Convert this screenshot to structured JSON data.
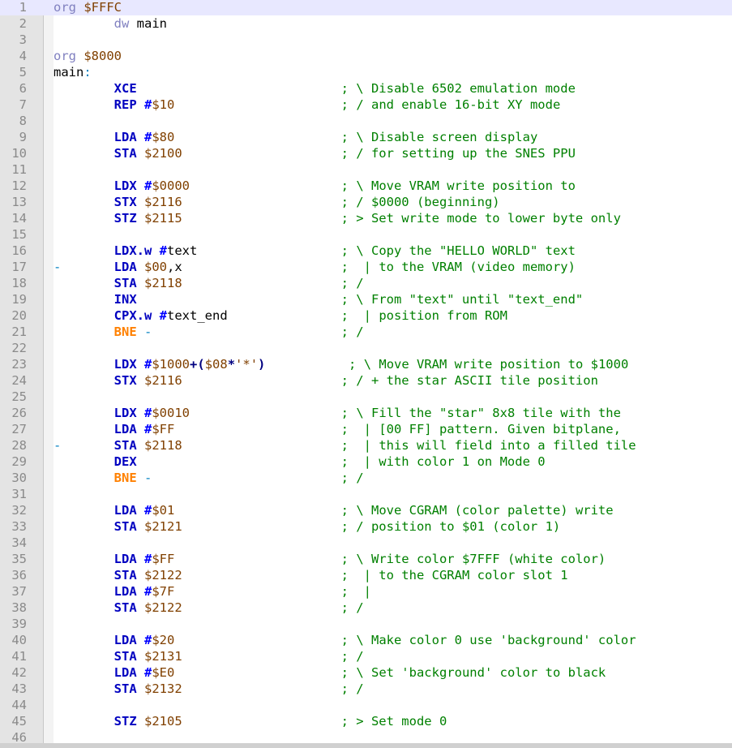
{
  "window": {
    "title": ""
  },
  "editor": {
    "current_line": 1,
    "lines": [
      {
        "n": "1",
        "tokens": [
          {
            "t": "org ",
            "c": "kw"
          },
          {
            "t": "$FFFC",
            "c": "hx"
          }
        ]
      },
      {
        "n": "2",
        "tokens": [
          {
            "t": "        "
          },
          {
            "t": "dw",
            "c": "kw"
          },
          {
            "t": " main"
          }
        ]
      },
      {
        "n": "3",
        "tokens": []
      },
      {
        "n": "4",
        "tokens": [
          {
            "t": "org ",
            "c": "kw"
          },
          {
            "t": "$8000",
            "c": "hx"
          }
        ]
      },
      {
        "n": "5",
        "tokens": [
          {
            "t": "main",
            "c": "lbl"
          },
          {
            "t": ":",
            "c": "sym"
          }
        ]
      },
      {
        "n": "6",
        "tokens": [
          {
            "t": "        "
          },
          {
            "t": "XCE",
            "c": "op"
          },
          {
            "t": "                           "
          },
          {
            "t": "; \\ Disable 6502 emulation mode",
            "c": "cm"
          }
        ]
      },
      {
        "n": "7",
        "tokens": [
          {
            "t": "        "
          },
          {
            "t": "REP",
            "c": "op"
          },
          {
            "t": " "
          },
          {
            "t": "#",
            "c": "im"
          },
          {
            "t": "$10",
            "c": "hx"
          },
          {
            "t": "                      "
          },
          {
            "t": "; / and enable 16-bit XY mode",
            "c": "cm"
          }
        ]
      },
      {
        "n": "8",
        "tokens": []
      },
      {
        "n": "9",
        "tokens": [
          {
            "t": "        "
          },
          {
            "t": "LDA",
            "c": "op"
          },
          {
            "t": " "
          },
          {
            "t": "#",
            "c": "im"
          },
          {
            "t": "$80",
            "c": "hx"
          },
          {
            "t": "                      "
          },
          {
            "t": "; \\ Disable screen display",
            "c": "cm"
          }
        ]
      },
      {
        "n": "10",
        "tokens": [
          {
            "t": "        "
          },
          {
            "t": "STA",
            "c": "op"
          },
          {
            "t": " "
          },
          {
            "t": "$2100",
            "c": "hx"
          },
          {
            "t": "                     "
          },
          {
            "t": "; / for setting up the SNES PPU",
            "c": "cm"
          }
        ]
      },
      {
        "n": "11",
        "tokens": []
      },
      {
        "n": "12",
        "tokens": [
          {
            "t": "        "
          },
          {
            "t": "LDX",
            "c": "op"
          },
          {
            "t": " "
          },
          {
            "t": "#",
            "c": "im"
          },
          {
            "t": "$0000",
            "c": "hx"
          },
          {
            "t": "                    "
          },
          {
            "t": "; \\ Move VRAM write position to",
            "c": "cm"
          }
        ]
      },
      {
        "n": "13",
        "tokens": [
          {
            "t": "        "
          },
          {
            "t": "STX",
            "c": "op"
          },
          {
            "t": " "
          },
          {
            "t": "$2116",
            "c": "hx"
          },
          {
            "t": "                     "
          },
          {
            "t": "; / $0000 (beginning)",
            "c": "cm"
          }
        ]
      },
      {
        "n": "14",
        "tokens": [
          {
            "t": "        "
          },
          {
            "t": "STZ",
            "c": "op"
          },
          {
            "t": " "
          },
          {
            "t": "$2115",
            "c": "hx"
          },
          {
            "t": "                     "
          },
          {
            "t": "; > Set write mode to lower byte only",
            "c": "cm"
          }
        ]
      },
      {
        "n": "15",
        "tokens": []
      },
      {
        "n": "16",
        "tokens": [
          {
            "t": "        "
          },
          {
            "t": "LDX.w",
            "c": "op"
          },
          {
            "t": " "
          },
          {
            "t": "#",
            "c": "im"
          },
          {
            "t": "text"
          },
          {
            "t": "                   "
          },
          {
            "t": "; \\ Copy the \"HELLO WORLD\" text",
            "c": "cm"
          }
        ]
      },
      {
        "n": "17",
        "tokens": [
          {
            "t": "-",
            "c": "sym"
          },
          {
            "t": "       "
          },
          {
            "t": "LDA",
            "c": "op"
          },
          {
            "t": " "
          },
          {
            "t": "$00",
            "c": "hx"
          },
          {
            "t": ",x"
          },
          {
            "t": "                     "
          },
          {
            "t": ";  | to the VRAM (video memory)",
            "c": "cm"
          }
        ]
      },
      {
        "n": "18",
        "tokens": [
          {
            "t": "        "
          },
          {
            "t": "STA",
            "c": "op"
          },
          {
            "t": " "
          },
          {
            "t": "$2118",
            "c": "hx"
          },
          {
            "t": "                     "
          },
          {
            "t": "; /",
            "c": "cm"
          }
        ]
      },
      {
        "n": "19",
        "tokens": [
          {
            "t": "        "
          },
          {
            "t": "INX",
            "c": "op"
          },
          {
            "t": "                           "
          },
          {
            "t": "; \\ From \"text\" until \"text_end\"",
            "c": "cm"
          }
        ]
      },
      {
        "n": "20",
        "tokens": [
          {
            "t": "        "
          },
          {
            "t": "CPX.w",
            "c": "op"
          },
          {
            "t": " "
          },
          {
            "t": "#",
            "c": "im"
          },
          {
            "t": "text_end"
          },
          {
            "t": "               "
          },
          {
            "t": ";  | position from ROM",
            "c": "cm"
          }
        ]
      },
      {
        "n": "21",
        "tokens": [
          {
            "t": "        "
          },
          {
            "t": "BNE",
            "c": "br"
          },
          {
            "t": " "
          },
          {
            "t": "-",
            "c": "sym"
          },
          {
            "t": "                         "
          },
          {
            "t": "; /",
            "c": "cm"
          }
        ]
      },
      {
        "n": "22",
        "tokens": []
      },
      {
        "n": "23",
        "tokens": [
          {
            "t": "        "
          },
          {
            "t": "LDX",
            "c": "op"
          },
          {
            "t": " "
          },
          {
            "t": "#",
            "c": "im"
          },
          {
            "t": "$1000",
            "c": "hx"
          },
          {
            "t": "+(",
            "c": "pr"
          },
          {
            "t": "$08",
            "c": "hx"
          },
          {
            "t": "*",
            "c": "pr"
          },
          {
            "t": "'*'",
            "c": "ch"
          },
          {
            "t": ")",
            "c": "pr"
          },
          {
            "t": "           "
          },
          {
            "t": "; \\ Move VRAM write position to $1000",
            "c": "cm"
          }
        ]
      },
      {
        "n": "24",
        "tokens": [
          {
            "t": "        "
          },
          {
            "t": "STX",
            "c": "op"
          },
          {
            "t": " "
          },
          {
            "t": "$2116",
            "c": "hx"
          },
          {
            "t": "                     "
          },
          {
            "t": "; / + the star ASCII tile position",
            "c": "cm"
          }
        ]
      },
      {
        "n": "25",
        "tokens": []
      },
      {
        "n": "26",
        "tokens": [
          {
            "t": "        "
          },
          {
            "t": "LDX",
            "c": "op"
          },
          {
            "t": " "
          },
          {
            "t": "#",
            "c": "im"
          },
          {
            "t": "$0010",
            "c": "hx"
          },
          {
            "t": "                    "
          },
          {
            "t": "; \\ Fill the \"star\" 8x8 tile with the",
            "c": "cm"
          }
        ]
      },
      {
        "n": "27",
        "tokens": [
          {
            "t": "        "
          },
          {
            "t": "LDA",
            "c": "op"
          },
          {
            "t": " "
          },
          {
            "t": "#",
            "c": "im"
          },
          {
            "t": "$FF",
            "c": "hx"
          },
          {
            "t": "                      "
          },
          {
            "t": ";  | [00 FF] pattern. Given bitplane,",
            "c": "cm"
          }
        ]
      },
      {
        "n": "28",
        "tokens": [
          {
            "t": "-",
            "c": "sym"
          },
          {
            "t": "       "
          },
          {
            "t": "STA",
            "c": "op"
          },
          {
            "t": " "
          },
          {
            "t": "$2118",
            "c": "hx"
          },
          {
            "t": "                     "
          },
          {
            "t": ";  | this will field into a filled tile",
            "c": "cm"
          }
        ]
      },
      {
        "n": "29",
        "tokens": [
          {
            "t": "        "
          },
          {
            "t": "DEX",
            "c": "op"
          },
          {
            "t": "                           "
          },
          {
            "t": ";  | with color 1 on Mode 0",
            "c": "cm"
          }
        ]
      },
      {
        "n": "30",
        "tokens": [
          {
            "t": "        "
          },
          {
            "t": "BNE",
            "c": "br"
          },
          {
            "t": " "
          },
          {
            "t": "-",
            "c": "sym"
          },
          {
            "t": "                         "
          },
          {
            "t": "; /",
            "c": "cm"
          }
        ]
      },
      {
        "n": "31",
        "tokens": []
      },
      {
        "n": "32",
        "tokens": [
          {
            "t": "        "
          },
          {
            "t": "LDA",
            "c": "op"
          },
          {
            "t": " "
          },
          {
            "t": "#",
            "c": "im"
          },
          {
            "t": "$01",
            "c": "hx"
          },
          {
            "t": "                      "
          },
          {
            "t": "; \\ Move CGRAM (color palette) write",
            "c": "cm"
          }
        ]
      },
      {
        "n": "33",
        "tokens": [
          {
            "t": "        "
          },
          {
            "t": "STA",
            "c": "op"
          },
          {
            "t": " "
          },
          {
            "t": "$2121",
            "c": "hx"
          },
          {
            "t": "                     "
          },
          {
            "t": "; / position to $01 (color 1)",
            "c": "cm"
          }
        ]
      },
      {
        "n": "34",
        "tokens": []
      },
      {
        "n": "35",
        "tokens": [
          {
            "t": "        "
          },
          {
            "t": "LDA",
            "c": "op"
          },
          {
            "t": " "
          },
          {
            "t": "#",
            "c": "im"
          },
          {
            "t": "$FF",
            "c": "hx"
          },
          {
            "t": "                      "
          },
          {
            "t": "; \\ Write color $7FFF (white color)",
            "c": "cm"
          }
        ]
      },
      {
        "n": "36",
        "tokens": [
          {
            "t": "        "
          },
          {
            "t": "STA",
            "c": "op"
          },
          {
            "t": " "
          },
          {
            "t": "$2122",
            "c": "hx"
          },
          {
            "t": "                     "
          },
          {
            "t": ";  | to the CGRAM color slot 1",
            "c": "cm"
          }
        ]
      },
      {
        "n": "37",
        "tokens": [
          {
            "t": "        "
          },
          {
            "t": "LDA",
            "c": "op"
          },
          {
            "t": " "
          },
          {
            "t": "#",
            "c": "im"
          },
          {
            "t": "$7F",
            "c": "hx"
          },
          {
            "t": "                      "
          },
          {
            "t": ";  |",
            "c": "cm"
          }
        ]
      },
      {
        "n": "38",
        "tokens": [
          {
            "t": "        "
          },
          {
            "t": "STA",
            "c": "op"
          },
          {
            "t": " "
          },
          {
            "t": "$2122",
            "c": "hx"
          },
          {
            "t": "                     "
          },
          {
            "t": "; /",
            "c": "cm"
          }
        ]
      },
      {
        "n": "39",
        "tokens": []
      },
      {
        "n": "40",
        "tokens": [
          {
            "t": "        "
          },
          {
            "t": "LDA",
            "c": "op"
          },
          {
            "t": " "
          },
          {
            "t": "#",
            "c": "im"
          },
          {
            "t": "$20",
            "c": "hx"
          },
          {
            "t": "                      "
          },
          {
            "t": "; \\ Make color 0 use 'background' color",
            "c": "cm"
          }
        ]
      },
      {
        "n": "41",
        "tokens": [
          {
            "t": "        "
          },
          {
            "t": "STA",
            "c": "op"
          },
          {
            "t": " "
          },
          {
            "t": "$2131",
            "c": "hx"
          },
          {
            "t": "                     "
          },
          {
            "t": "; /",
            "c": "cm"
          }
        ]
      },
      {
        "n": "42",
        "tokens": [
          {
            "t": "        "
          },
          {
            "t": "LDA",
            "c": "op"
          },
          {
            "t": " "
          },
          {
            "t": "#",
            "c": "im"
          },
          {
            "t": "$E0",
            "c": "hx"
          },
          {
            "t": "                      "
          },
          {
            "t": "; \\ Set 'background' color to black",
            "c": "cm"
          }
        ]
      },
      {
        "n": "43",
        "tokens": [
          {
            "t": "        "
          },
          {
            "t": "STA",
            "c": "op"
          },
          {
            "t": " "
          },
          {
            "t": "$2132",
            "c": "hx"
          },
          {
            "t": "                     "
          },
          {
            "t": "; /",
            "c": "cm"
          }
        ]
      },
      {
        "n": "44",
        "tokens": []
      },
      {
        "n": "45",
        "tokens": [
          {
            "t": "        "
          },
          {
            "t": "STZ",
            "c": "op"
          },
          {
            "t": " "
          },
          {
            "t": "$2105",
            "c": "hx"
          },
          {
            "t": "                     "
          },
          {
            "t": "; > Set mode 0",
            "c": "cm"
          }
        ]
      },
      {
        "n": "46",
        "tokens": []
      }
    ]
  }
}
